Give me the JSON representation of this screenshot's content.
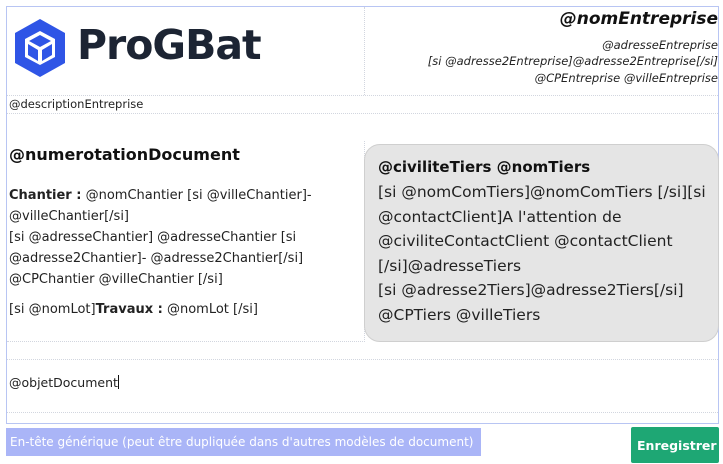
{
  "colors": {
    "brand_blue": "#2f55e6",
    "save_green": "#1ea774",
    "badge_blue": "#aab5f7",
    "client_box_grey": "#e5e5e5"
  },
  "header": {
    "logo": {
      "icon": "progbat-cube-icon",
      "text": "ProGBat"
    },
    "company": {
      "name": "@nomEntreprise",
      "line1": "@adresseEntreprise",
      "line2": "[si @adresse2Entreprise]@adresse2Entreprise[/si]",
      "line3": "@CPEntreprise @villeEntreprise"
    },
    "description": "@descriptionEntreprise"
  },
  "document": {
    "number": "@numerotationDocument",
    "site_label": "Chantier :",
    "site_text": " @nomChantier [si @villeChantier]- @villeChantier[/si]",
    "address_line1": "[si @adresseChantier] @adresseChantier [si @adresse2Chantier]- @adresse2Chantier[/si]",
    "address_line2": "@CPChantier @villeChantier [/si]",
    "lot_prefix": "[si @nomLot]",
    "lot_label": "Travaux :",
    "lot_text": " @nomLot [/si]"
  },
  "client": {
    "title": "@civiliteTiers @nomTiers",
    "lines": "[si @nomComTiers]@nomComTiers [/si][si @contactClient]A l'attention de @civiliteContactClient @contactClient [/si]@adresseTiers",
    "line2": "[si @adresse2Tiers]@adresse2Tiers[/si]",
    "line3": "@CPTiers @villeTiers"
  },
  "object": {
    "text": "@objetDocument"
  },
  "footer": {
    "generic_label": "En-tête générique (peut être dupliquée dans d'autres modèles de document)",
    "save_label": "Enregistrer"
  }
}
